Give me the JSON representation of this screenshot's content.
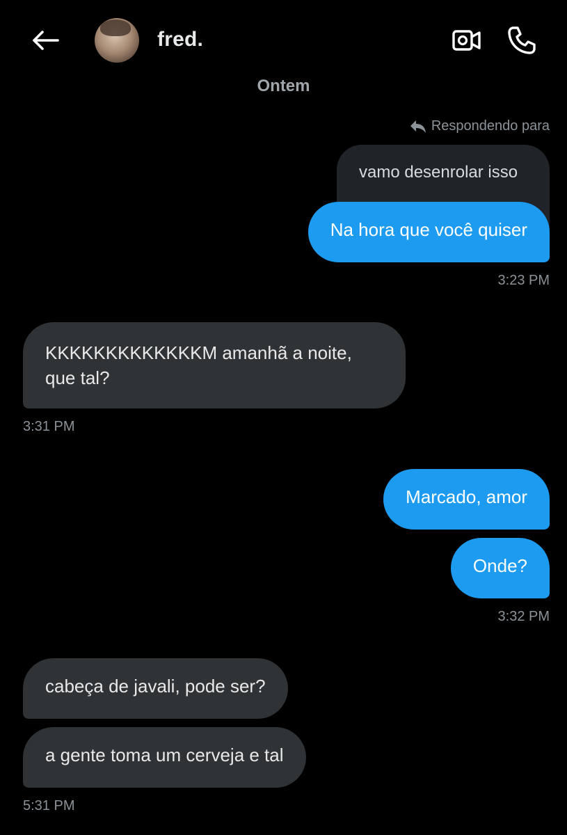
{
  "header": {
    "name": "fred.",
    "icons": {
      "back": "arrow-left-icon",
      "video": "video-camera-icon",
      "call": "phone-icon"
    }
  },
  "date_separator": "Ontem",
  "reply_indicator": {
    "label": "Respondendo para",
    "icon": "reply-arrow-icon"
  },
  "quoted_message": "vamo desenrolar isso",
  "messages": [
    {
      "direction": "out",
      "text": "Na hora que você quiser"
    },
    {
      "direction": "in",
      "text_line1": "KKKKKKKKKKKKKM amanhã a noite,",
      "text_line2": "que tal?"
    },
    {
      "direction": "out",
      "text": "Marcado, amor"
    },
    {
      "direction": "out",
      "text": "Onde?"
    },
    {
      "direction": "in",
      "text": "cabeça de javali, pode ser?"
    },
    {
      "direction": "in",
      "text": "a gente toma um cerveja e tal"
    }
  ],
  "timestamps": [
    "3:23 PM",
    "3:31 PM",
    "3:32 PM",
    "5:31 PM"
  ],
  "colors": {
    "background": "#000000",
    "outgoing_bubble": "#1d9bf0",
    "incoming_bubble": "#2f3336",
    "secondary_text": "#8b9298"
  }
}
